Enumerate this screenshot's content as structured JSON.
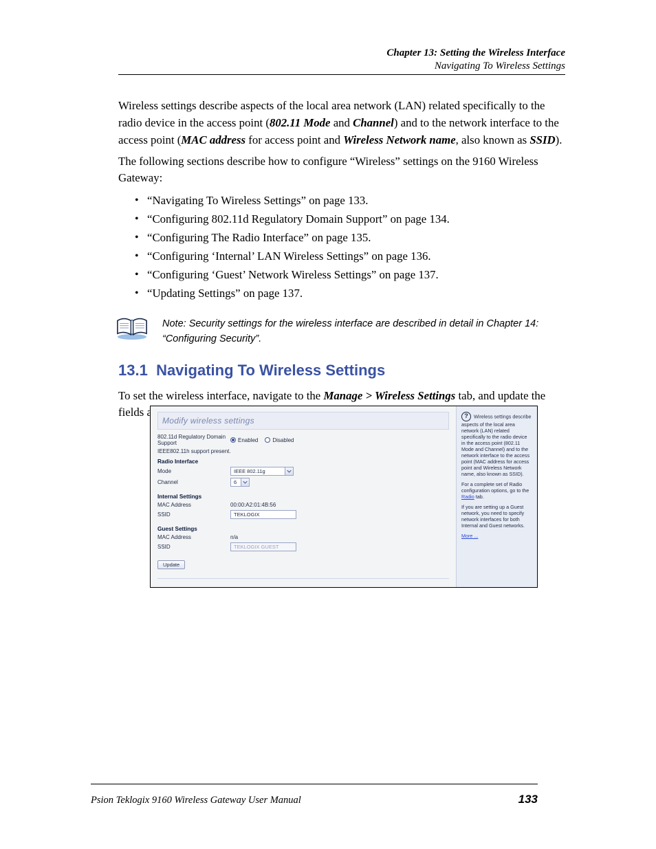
{
  "header": {
    "chapter": "Chapter 13: Setting the Wireless Interface",
    "section": "Navigating To Wireless Settings"
  },
  "paragraphs": {
    "p1a": "Wireless settings describe aspects of the local area network (LAN) related specifically to the radio device in the access point (",
    "p1b": " and ",
    "p1c": ") and to the network interface to the access point (",
    "p1d": " for access point and ",
    "p1e": ", also known as ",
    "p1f": ").",
    "t_mode": "802.11 Mode",
    "t_channel": "Channel",
    "t_mac": "MAC address",
    "t_wnn": "Wireless Network name",
    "t_ssid": "SSID",
    "p2": "The following sections describe how to configure “Wireless” settings on the 9160 Wireless Gateway:",
    "items": [
      "“Navigating To Wireless Settings” on page 133.",
      "“Configuring 802.11d Regulatory Domain Support” on page 134.",
      "“Configuring The Radio Interface” on page 135.",
      "“Configuring ‘Internal’ LAN Wireless Settings” on page 136.",
      "“Configuring ‘Guest’ Network Wireless Settings” on page 137.",
      "“Updating Settings” on page 137."
    ],
    "note_a": "Note: ",
    "note_b": "Security settings for the wireless interface are described in detail in ",
    "note_c": ".",
    "note_ref": "Chapter 14: “Configuring Security”",
    "h1_no": "13.1",
    "h1_txt": "Navigating To Wireless Settings",
    "p3": "To set the wireless interface, navigate to the Manage > Wireless Settings tab, and update the fields as described below."
  },
  "shot": {
    "title": "Modify wireless settings",
    "reg_label": "802.11d Regulatory Domain Support",
    "reg_enabled": "Enabled",
    "reg_disabled": "Disabled",
    "ieee11h": "IEEE802.11h support present.",
    "h_radio": "Radio Interface",
    "l_mode": "Mode",
    "v_mode": "IEEE 802.11g",
    "l_channel": "Channel",
    "v_channel": "6",
    "h_internal": "Internal Settings",
    "l_mac": "MAC Address",
    "v_mac_internal": "00:00:A2:01:4B:56",
    "l_ssid": "SSID",
    "v_ssid_internal": "TEKLOGIX",
    "h_guest": "Guest Settings",
    "v_mac_guest": "n/a",
    "v_ssid_guest": "TEKLOGIX GUEST",
    "btn_update": "Update",
    "side": {
      "p1": "Wireless settings describe aspects of the local area network (LAN) related specifically to the radio device in the access point (802.11 Mode and Channel) and to the network interface to the access point (MAC address for access point and Wireless Network name, also known as SSID).",
      "p2a": "For a complete set of Radio configuration options, go to the ",
      "radio_link": "Radio",
      "p2b": " tab.",
      "p3": "If you are setting up a Guest network, you need to specify network interfaces for both Internal and Guest networks.",
      "more": "More ..."
    }
  },
  "footer": {
    "text": "Psion Teklogix 9160 Wireless Gateway User Manual",
    "page": "133"
  }
}
